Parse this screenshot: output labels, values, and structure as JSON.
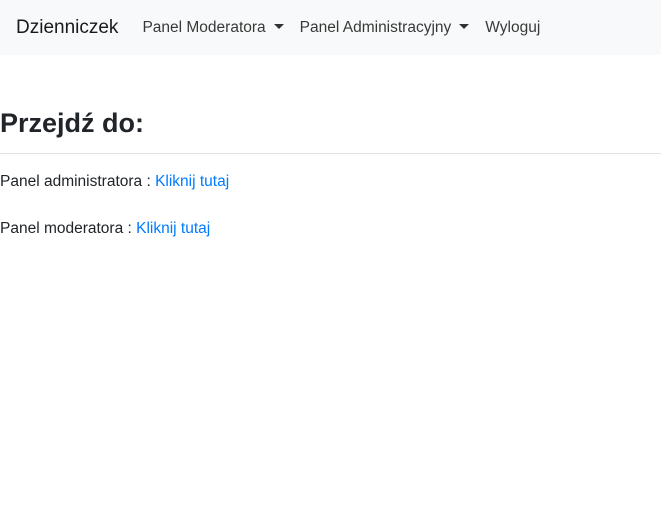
{
  "navbar": {
    "brand": "Dzienniczek",
    "items": [
      {
        "label": "Panel Moderatora",
        "dropdown": true
      },
      {
        "label": "Panel Administracyjny",
        "dropdown": true
      },
      {
        "label": "Wyloguj",
        "dropdown": false
      }
    ]
  },
  "main": {
    "heading": "Przejdź do:",
    "rows": [
      {
        "label": "Panel administratora : ",
        "link": "Kliknij tutaj"
      },
      {
        "label": "Panel moderatora : ",
        "link": "Kliknij tutaj"
      }
    ]
  },
  "colors": {
    "navbar_bg": "#f8f9fa",
    "link": "#007bff",
    "divider": "#dee2e6"
  }
}
